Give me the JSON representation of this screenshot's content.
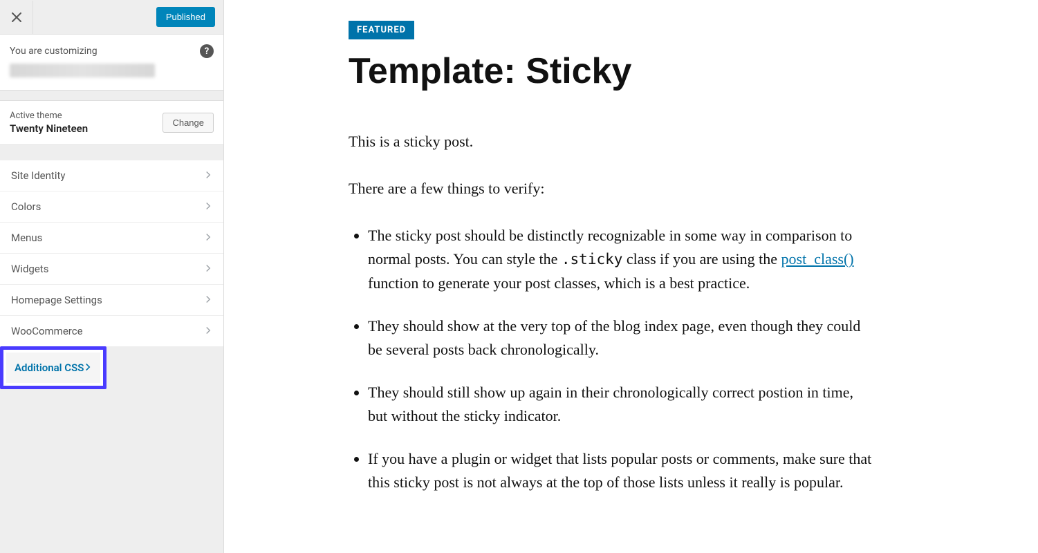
{
  "sidebar": {
    "published_label": "Published",
    "customizing_label": "You are customizing",
    "active_theme_label": "Active theme",
    "theme_name": "Twenty Nineteen",
    "change_label": "Change",
    "items": [
      {
        "label": "Site Identity"
      },
      {
        "label": "Colors"
      },
      {
        "label": "Menus"
      },
      {
        "label": "Widgets"
      },
      {
        "label": "Homepage Settings"
      },
      {
        "label": "WooCommerce"
      },
      {
        "label": "Additional CSS",
        "highlighted": true
      }
    ]
  },
  "preview": {
    "featured_badge": "FEATURED",
    "title": "Template: Sticky",
    "intro_1": "This is a sticky post.",
    "intro_2": "There are a few things to verify:",
    "bullet1_a": "The sticky post should be distinctly recognizable in some way in comparison to normal posts. You can style the ",
    "bullet1_code": ".sticky",
    "bullet1_b": " class if you are using the ",
    "bullet1_link": "post_class()",
    "bullet1_c": " function to generate your post classes, which is a best practice.",
    "bullet2": "They should show at the very top of the blog index page, even though they could be several posts back chronologically.",
    "bullet3": "They should still show up again in their chronologically correct postion in time, but without the sticky indicator.",
    "bullet4": "If you have a plugin or widget that lists popular posts or comments, make sure that this sticky post is not always at the top of those lists unless it really is popular."
  }
}
